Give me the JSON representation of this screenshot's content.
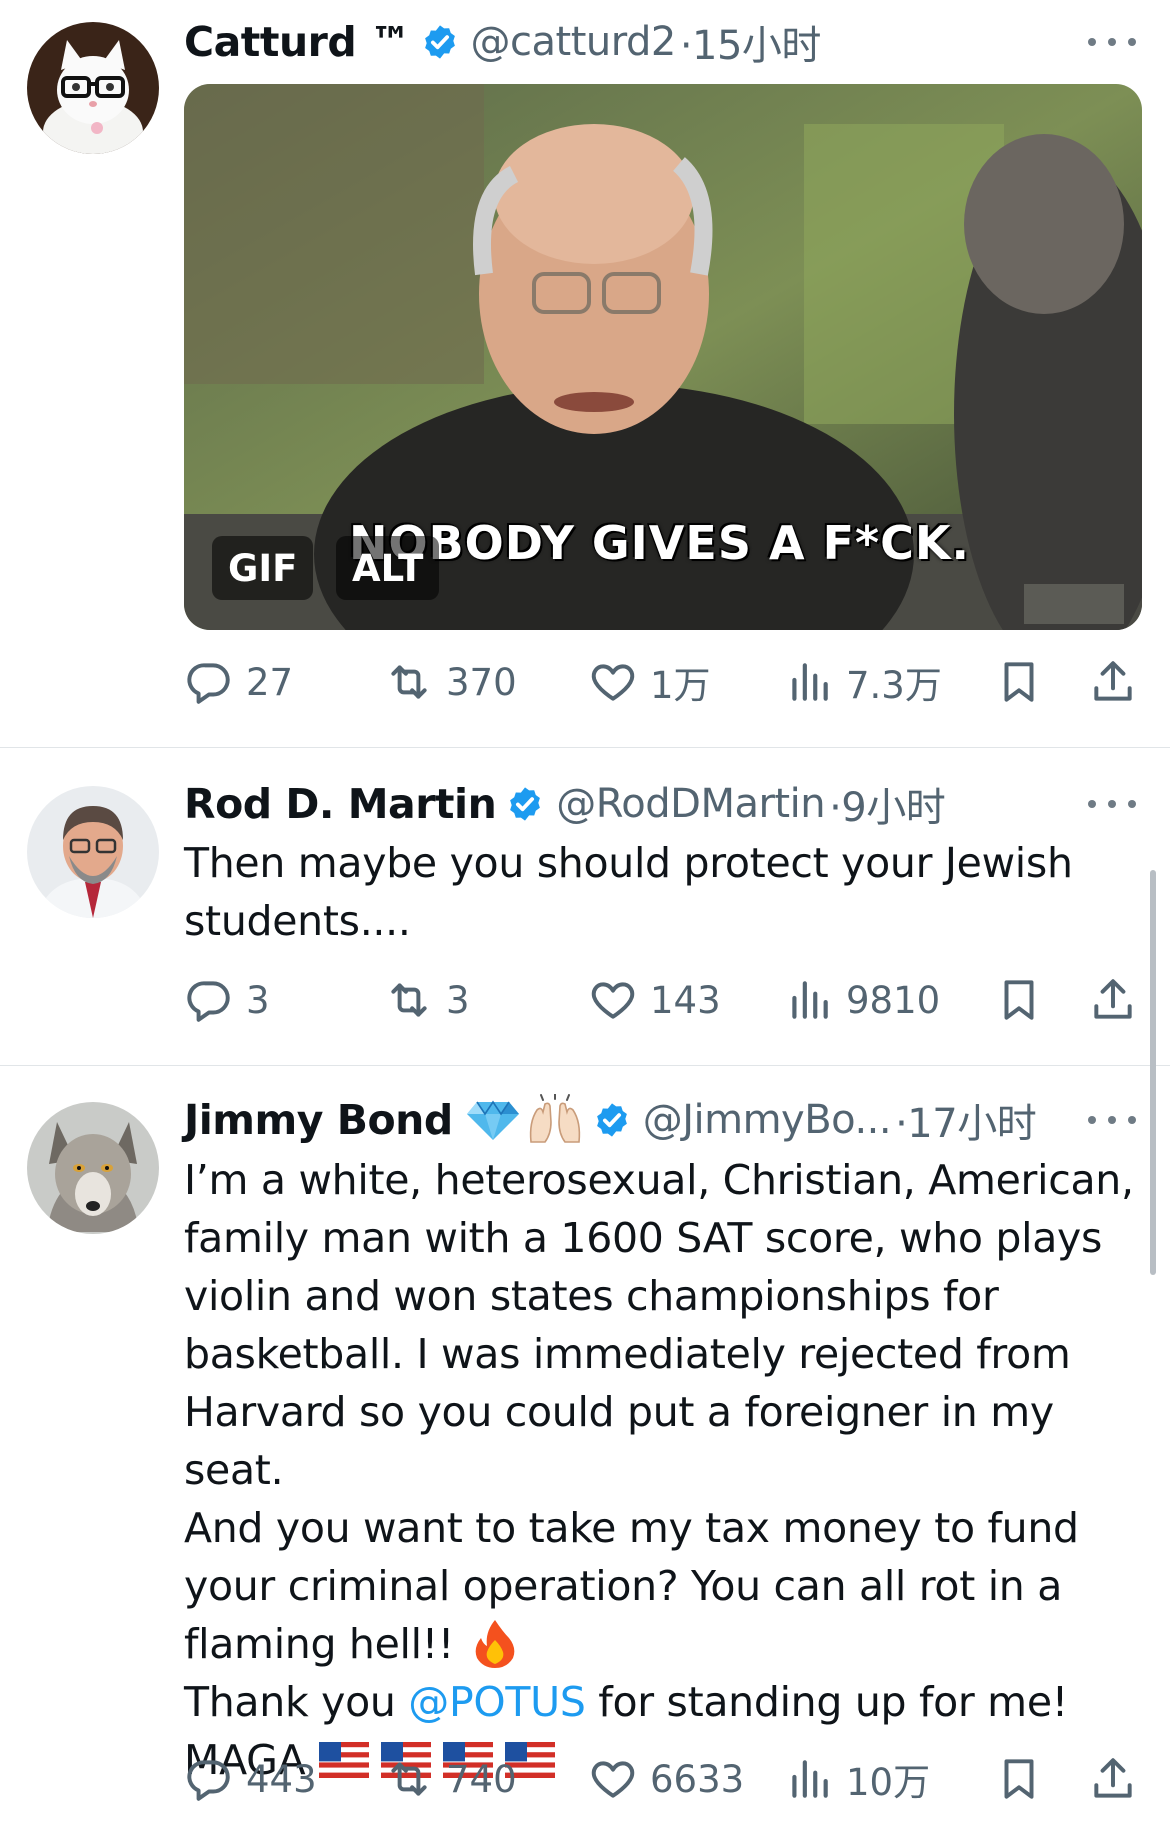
{
  "tweets": [
    {
      "name": "Catturd ™",
      "handle": "@catturd2",
      "time": "·15小时",
      "media": {
        "gif_label": "GIF",
        "alt_label": "ALT",
        "caption": "NOBODY GIVES A F*CK."
      },
      "replies": "27",
      "retweets": "370",
      "likes": "1万",
      "views": "7.3万"
    },
    {
      "name": "Rod D. Martin",
      "handle": "@RodDMartin",
      "time": "·9小时",
      "text_lines": [
        "Then maybe you should protect your Jewish",
        "students...."
      ],
      "replies": "3",
      "retweets": "3",
      "likes": "143",
      "views": "9810"
    },
    {
      "name": "Jimmy Bond",
      "name_emojis": [
        "gem-stone-emoji",
        "raising-hands-emoji"
      ],
      "handle": "@JimmyBo...",
      "time": "·17小时",
      "text_lines": [
        "I’m a white, heterosexual, Christian, American,",
        "family man with a 1600 SAT score, who plays",
        "violin and won states championships for",
        "basketball. I was immediately rejected from",
        "Harvard so you could put a foreigner in my seat.",
        "And you want to take my tax money to fund",
        "your criminal operation? You can all rot in a",
        "flaming hell!!"
      ],
      "thanks_prefix": "Thank you ",
      "mention": "@POTUS",
      "thanks_suffix": " for standing up for me!",
      "maga": "MAGA",
      "replies": "443",
      "retweets": "740",
      "likes": "6633",
      "views": "10万"
    }
  ],
  "colors": {
    "verified": "#1d9bf0",
    "mention": "#1d9bf0",
    "muted": "#536471",
    "separator": "#e1e5e8"
  }
}
